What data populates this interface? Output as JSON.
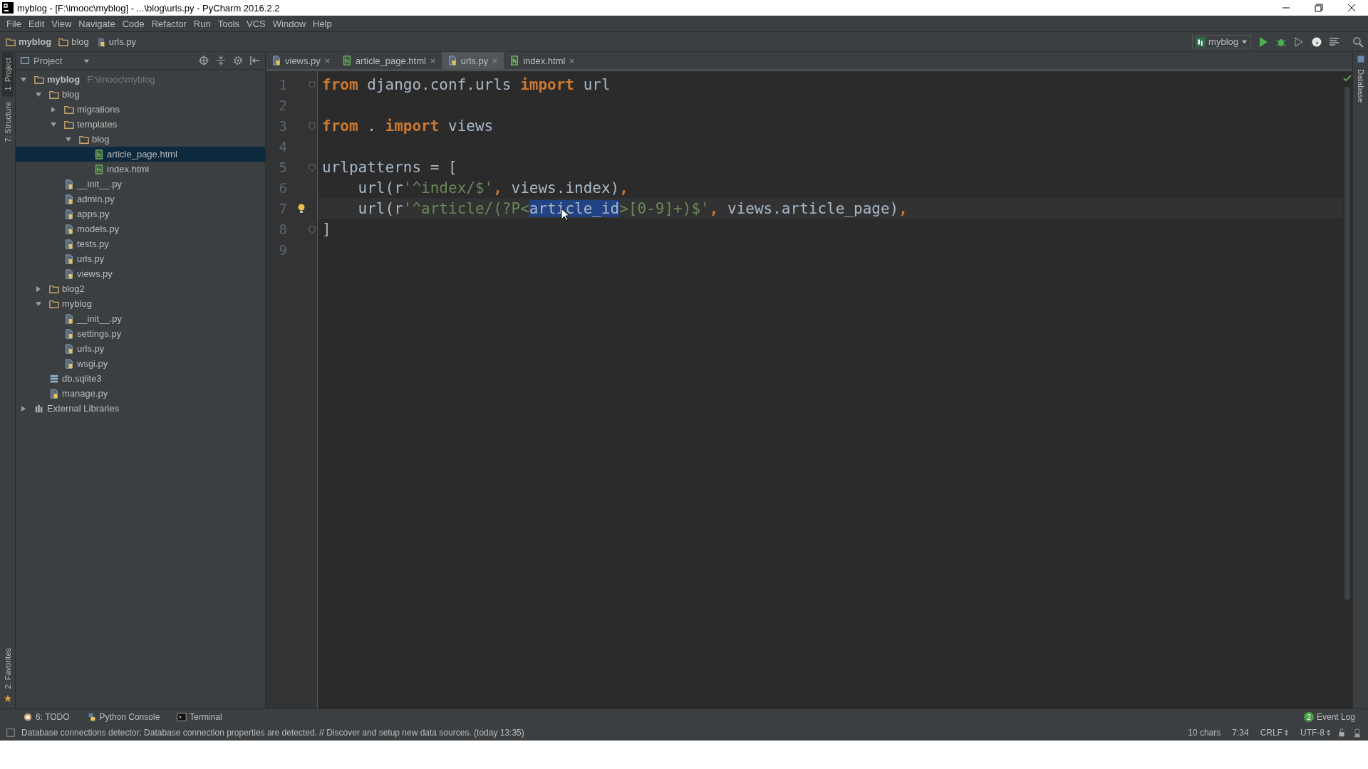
{
  "window": {
    "title": "myblog - [F:\\imooc\\myblog] - ...\\blog\\urls.py - PyCharm 2016.2.2"
  },
  "menu": [
    "File",
    "Edit",
    "View",
    "Navigate",
    "Code",
    "Refactor",
    "Run",
    "Tools",
    "VCS",
    "Window",
    "Help"
  ],
  "breadcrumbs": [
    {
      "label": "myblog",
      "bold": true
    },
    {
      "label": "blog",
      "bold": false
    },
    {
      "label": "urls.py",
      "bold": false
    }
  ],
  "run_config": {
    "label": "myblog"
  },
  "left_stripe": [
    {
      "label": "1: Project",
      "selected": true
    },
    {
      "label": "7: Structure",
      "selected": false
    }
  ],
  "left_stripe_bottom": [
    {
      "label": "2: Favorites"
    }
  ],
  "right_stripe": [
    {
      "label": "Database"
    }
  ],
  "project_panel": {
    "title": "Project",
    "tree": [
      {
        "name": "myblog",
        "hint": "F:\\imooc\\myblog",
        "kind": "folder",
        "expanded": true,
        "selected": false,
        "children": [
          {
            "name": "blog",
            "kind": "folder",
            "expanded": true,
            "selected": false,
            "children": [
              {
                "name": "migrations",
                "kind": "folder",
                "expanded": false,
                "selected": false
              },
              {
                "name": "templates",
                "kind": "folder",
                "expanded": true,
                "selected": false,
                "children": [
                  {
                    "name": "blog",
                    "kind": "folder",
                    "expanded": true,
                    "selected": false,
                    "children": [
                      {
                        "name": "article_page.html",
                        "kind": "html",
                        "selected": true
                      },
                      {
                        "name": "index.html",
                        "kind": "html",
                        "selected": false
                      }
                    ]
                  }
                ]
              },
              {
                "name": "__init__.py",
                "kind": "python",
                "selected": false
              },
              {
                "name": "admin.py",
                "kind": "python",
                "selected": false
              },
              {
                "name": "apps.py",
                "kind": "python",
                "selected": false
              },
              {
                "name": "models.py",
                "kind": "python",
                "selected": false
              },
              {
                "name": "tests.py",
                "kind": "python",
                "selected": false
              },
              {
                "name": "urls.py",
                "kind": "python",
                "selected": false
              },
              {
                "name": "views.py",
                "kind": "python",
                "selected": false
              }
            ]
          },
          {
            "name": "blog2",
            "kind": "folder",
            "expanded": false,
            "selected": false
          },
          {
            "name": "myblog",
            "kind": "folder",
            "expanded": true,
            "selected": false,
            "children": [
              {
                "name": "__init__.py",
                "kind": "python",
                "selected": false
              },
              {
                "name": "settings.py",
                "kind": "python",
                "selected": false
              },
              {
                "name": "urls.py",
                "kind": "python",
                "selected": false
              },
              {
                "name": "wsgi.py",
                "kind": "python",
                "selected": false
              }
            ]
          },
          {
            "name": "db.sqlite3",
            "kind": "database",
            "selected": false
          },
          {
            "name": "manage.py",
            "kind": "python",
            "selected": false
          }
        ]
      },
      {
        "name": "External Libraries",
        "kind": "libraries",
        "expanded": false,
        "selected": false
      }
    ]
  },
  "editor_tabs": [
    {
      "label": "views.py",
      "kind": "python",
      "selected": false
    },
    {
      "label": "article_page.html",
      "kind": "html",
      "selected": false
    },
    {
      "label": "urls.py",
      "kind": "python",
      "selected": true
    },
    {
      "label": "index.html",
      "kind": "html",
      "selected": false
    }
  ],
  "code_lines": [
    {
      "number": "1",
      "fold": true,
      "bulb": false,
      "tokens": [
        {
          "kind": "keyword",
          "text": "from"
        },
        {
          "kind": "plain",
          "text": " django.conf.urls "
        },
        {
          "kind": "keyword",
          "text": "import"
        },
        {
          "kind": "plain",
          "text": " url"
        }
      ]
    },
    {
      "number": "2",
      "fold": false,
      "bulb": false
    },
    {
      "number": "3",
      "fold": true,
      "bulb": false,
      "tokens": [
        {
          "kind": "keyword",
          "text": "from"
        },
        {
          "kind": "plain",
          "text": " . "
        },
        {
          "kind": "keyword",
          "text": "import"
        },
        {
          "kind": "plain",
          "text": " views"
        }
      ]
    },
    {
      "number": "4",
      "fold": false,
      "bulb": false
    },
    {
      "number": "5",
      "fold": true,
      "bulb": false,
      "tokens": [
        {
          "kind": "plain",
          "text": "urlpatterns = ["
        }
      ]
    },
    {
      "number": "6",
      "fold": false,
      "bulb": false,
      "tokens": [
        {
          "kind": "plain",
          "text": "    url(r"
        },
        {
          "kind": "string",
          "text": "'^index/$'"
        },
        {
          "kind": "keyword",
          "text": ","
        },
        {
          "kind": "plain",
          "text": " views.index)"
        },
        {
          "kind": "keyword",
          "text": ","
        }
      ]
    },
    {
      "number": "7",
      "fold": false,
      "bulb": true,
      "tokens": [
        {
          "kind": "plain",
          "text": "    url(r"
        },
        {
          "kind": "string",
          "text": "'^article/(?P<"
        },
        {
          "kind": "selection",
          "text": "article_id"
        },
        {
          "kind": "string",
          "text": ">[0-9]+)$'"
        },
        {
          "kind": "keyword",
          "text": ","
        },
        {
          "kind": "plain",
          "text": " views.article_page)"
        },
        {
          "kind": "keyword",
          "text": ","
        }
      ]
    },
    {
      "number": "8",
      "fold": true,
      "bulb": false,
      "tokens": [
        {
          "kind": "plain",
          "text": "]"
        }
      ]
    },
    {
      "number": "9",
      "fold": false,
      "bulb": false
    }
  ],
  "tool_buttons": [
    {
      "label": "6: TODO",
      "kind": "todo"
    },
    {
      "label": "Python Console",
      "kind": "console"
    },
    {
      "label": "Terminal",
      "kind": "terminal"
    }
  ],
  "event_log": {
    "label": "Event Log",
    "count": "2"
  },
  "status_bar": {
    "message": "Database connections detector: Database connection properties are detected. // Discover and setup new data sources. (today 13:35)",
    "items": [
      {
        "label": "10 chars",
        "kind": "text"
      },
      {
        "label": "7:34",
        "kind": "text"
      },
      {
        "label": "CRLF",
        "kind": "switch"
      },
      {
        "label": "UTF-8",
        "kind": "switch"
      }
    ]
  }
}
